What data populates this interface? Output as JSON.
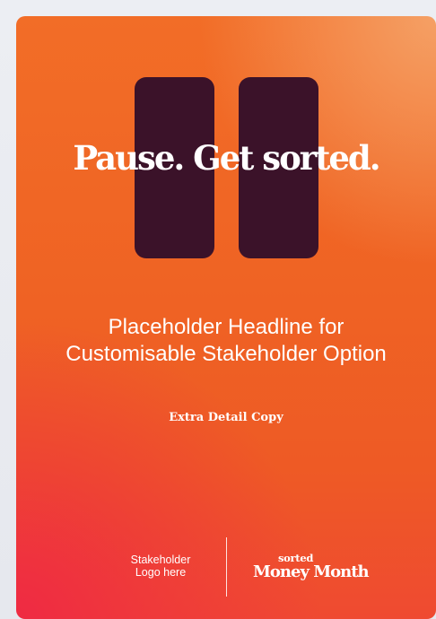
{
  "poster": {
    "hero_text": "Pause. Get sorted.",
    "headline_lines": [
      "Placeholder Headline for",
      "Customisable Stakeholder Option"
    ],
    "detail": "Extra Detail Copy",
    "stakeholder_logo_lines": [
      "Stakeholder",
      "Logo here"
    ],
    "brand": {
      "small": "sorted",
      "big": "Money Month"
    }
  },
  "colors": {
    "background": "#e9ebf0",
    "card_orange": "#f06a26",
    "card_red": "#ef2a43",
    "card_peach": "#f5a065",
    "pause_bars": "#3b1229",
    "text": "#ffffff"
  }
}
